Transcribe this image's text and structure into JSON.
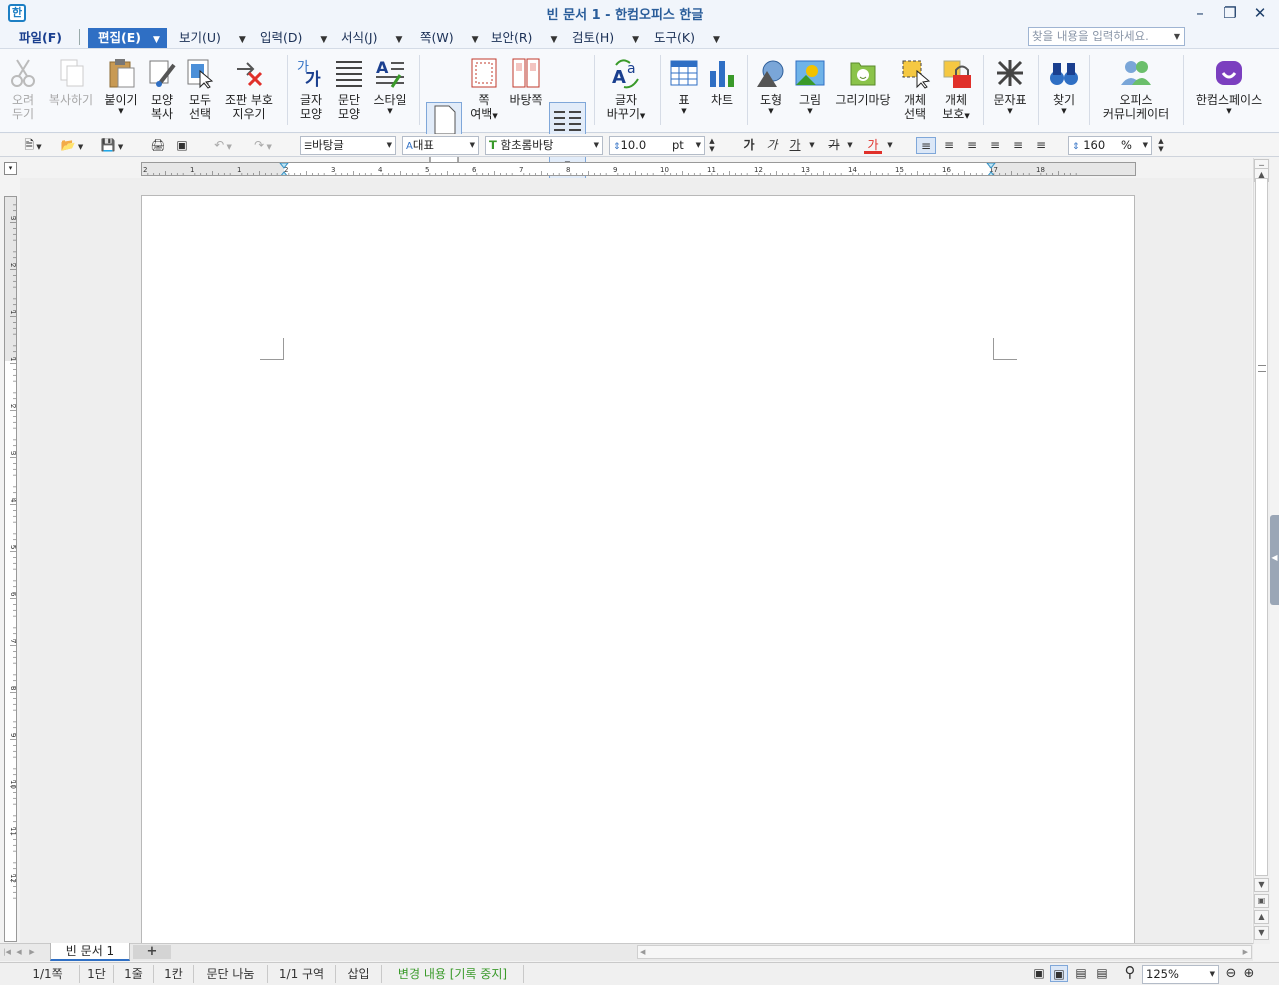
{
  "window": {
    "title": "빈 문서 1 - 한컴오피스 한글",
    "app_icon": "hwp-logo-icon"
  },
  "menu": {
    "file": "파일(F)",
    "items": [
      "편집(E)",
      "보기(U)",
      "입력(D)",
      "서식(J)",
      "쪽(W)",
      "보안(R)",
      "검토(H)",
      "도구(K)"
    ],
    "search_placeholder": "찾을 내용을 입력하세요."
  },
  "ribbon": {
    "cut": [
      "오려",
      "두기"
    ],
    "copy": "복사하기",
    "paste": "붙이기",
    "format_copy": [
      "모양",
      "복사"
    ],
    "select_all": [
      "모두",
      "선택"
    ],
    "erase_marks": [
      "조판 부호",
      "지우기"
    ],
    "char_shape": [
      "글자",
      "모양"
    ],
    "para_shape": [
      "문단",
      "모양"
    ],
    "style": "스타일",
    "page_margin": [
      "쪽",
      "여백"
    ],
    "background_page": "바탕쪽",
    "columns": "단",
    "char_change": [
      "글자",
      "바꾸기"
    ],
    "table": "표",
    "chart": "차트",
    "shape": "도형",
    "picture": "그림",
    "draw_gallery": "그리기마당",
    "object_select": [
      "개체",
      "선택"
    ],
    "object_protect": [
      "개체",
      "보호"
    ],
    "char_map": "문자표",
    "find": "찾기",
    "office_comm": [
      "오피스",
      "커뮤니케이터"
    ],
    "hancom_space": "한컴스페이스"
  },
  "format": {
    "style": "바탕글",
    "lang": "대표",
    "font": "함초롬바탕",
    "size": "10.0",
    "unit": "pt",
    "bold": "가",
    "italic": "가",
    "underline": "가",
    "strike": "가",
    "color": "가",
    "line_spacing": "160",
    "percent": "%"
  },
  "ruler_h": [
    "2",
    "1",
    "1",
    "2",
    "3",
    "4",
    "5",
    "6",
    "7",
    "8",
    "9",
    "10",
    "11",
    "12",
    "13",
    "14",
    "15",
    "16",
    "17",
    "18"
  ],
  "ruler_v": [
    "3",
    "2",
    "1",
    "1",
    "2",
    "3",
    "4",
    "5",
    "6",
    "7",
    "8",
    "9",
    "10",
    "11",
    "12"
  ],
  "tabs": {
    "doc": "빈 문서 1",
    "add": "+"
  },
  "status": {
    "page": "1/1쪽",
    "col": "1단",
    "line": "1줄",
    "cell": "1칸",
    "para": "문단 나눔",
    "section": "1/1 구역",
    "mode": "삽입",
    "track": "변경 내용 [기록 중지]",
    "zoom": "125%"
  },
  "colors": {
    "accent": "#2f6fc4",
    "track": "#3a9a2a"
  }
}
